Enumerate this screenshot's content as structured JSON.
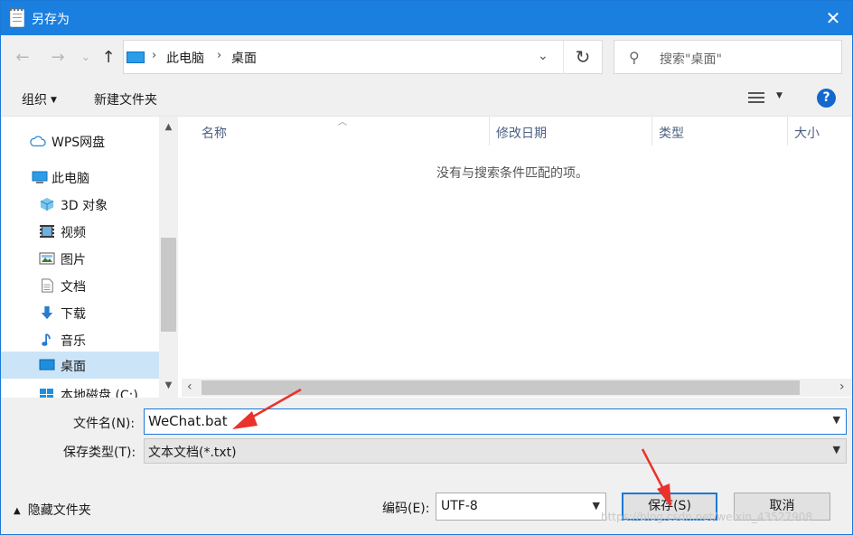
{
  "window": {
    "title": "另存为",
    "close_glyph": "✕"
  },
  "address": {
    "back_glyph": "←",
    "forward_glyph": "→",
    "recent_glyph": "⌄",
    "up_glyph": "↑",
    "crumbs": [
      "此电脑",
      "桌面"
    ],
    "separator": "›",
    "dropdown_glyph": "⌄",
    "refresh_glyph": "↻"
  },
  "search": {
    "placeholder": "搜索\"桌面\"",
    "icon_glyph": "⚲"
  },
  "toolbar": {
    "organize_label": "组织",
    "new_folder_label": "新建文件夹",
    "help_label": "?"
  },
  "nav": {
    "items": [
      {
        "label": "WPS网盘",
        "icon": "cloud-icon"
      },
      {
        "label": "此电脑",
        "icon": "computer-icon"
      },
      {
        "label": "3D 对象",
        "icon": "cube-icon"
      },
      {
        "label": "视频",
        "icon": "video-icon"
      },
      {
        "label": "图片",
        "icon": "picture-icon"
      },
      {
        "label": "文档",
        "icon": "document-icon"
      },
      {
        "label": "下载",
        "icon": "download-icon"
      },
      {
        "label": "音乐",
        "icon": "music-icon"
      },
      {
        "label": "桌面",
        "icon": "desktop-icon",
        "selected": true
      },
      {
        "label": "本地磁盘 (C:)",
        "icon": "drive-icon"
      }
    ]
  },
  "list": {
    "columns": [
      "名称",
      "修改日期",
      "类型",
      "大小"
    ],
    "empty_message": "没有与搜索条件匹配的项。"
  },
  "form": {
    "filename_label": "文件名(N):",
    "filename_value": "WeChat.bat",
    "filetype_label": "保存类型(T):",
    "filetype_value": "文本文档(*.txt)",
    "encoding_label": "编码(E):",
    "encoding_value": "UTF-8"
  },
  "footer": {
    "hide_folders_label": "隐藏文件夹",
    "save_label": "保存(S)",
    "cancel_label": "取消"
  },
  "watermark": "https://blog.csdn.net/weixin_43527908",
  "colors": {
    "titlebar": "#1b7fe0",
    "accent": "#1a78d7",
    "annotation_arrow": "#e8322b",
    "selection": "#cce4f7"
  }
}
